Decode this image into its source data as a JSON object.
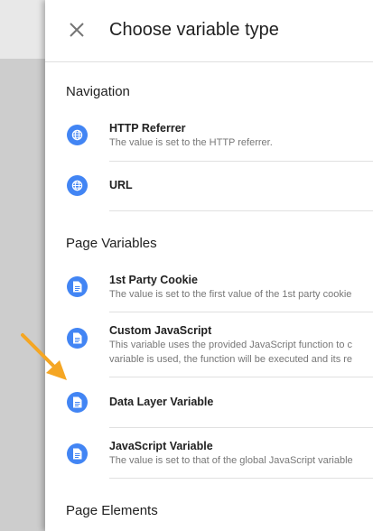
{
  "dialog": {
    "title": "Choose variable type",
    "close_icon": "close-icon"
  },
  "sections": {
    "navigation": {
      "title": "Navigation",
      "items": [
        {
          "name": "HTTP Referrer",
          "desc": "The value is set to the HTTP referrer.",
          "icon": "globe-icon"
        },
        {
          "name": "URL",
          "desc": "",
          "icon": "globe-icon"
        }
      ]
    },
    "page_variables": {
      "title": "Page Variables",
      "items": [
        {
          "name": "1st Party Cookie",
          "desc": "The value is set to the first value of the 1st party cookie",
          "icon": "document-icon"
        },
        {
          "name": "Custom JavaScript",
          "desc": "This variable uses the provided JavaScript function to c",
          "desc2": "variable is used, the function will be executed and its re",
          "icon": "document-icon"
        },
        {
          "name": "Data Layer Variable",
          "desc": "",
          "icon": "document-icon"
        },
        {
          "name": "JavaScript Variable",
          "desc": "The value is set to that of the global JavaScript variable",
          "icon": "document-icon"
        }
      ]
    },
    "page_elements": {
      "title": "Page Elements"
    }
  },
  "colors": {
    "icon_bg": "#4285f4",
    "annotation_arrow": "#f5a623"
  }
}
